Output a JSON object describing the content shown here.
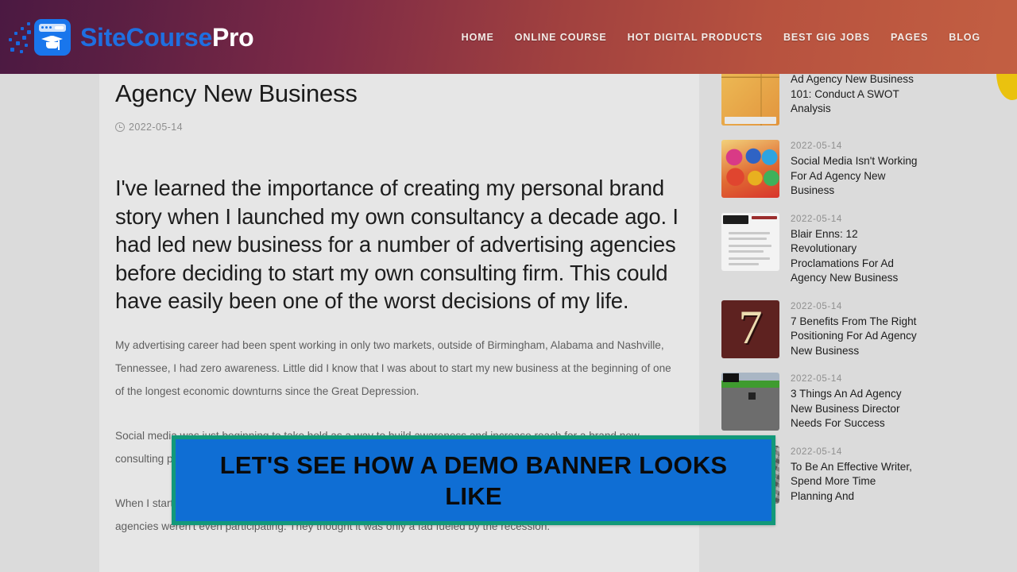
{
  "header": {
    "brand_primary": "SiteCourse",
    "brand_secondary": "Pro",
    "nav": [
      {
        "label": "HOME"
      },
      {
        "label": "ONLINE COURSE"
      },
      {
        "label": "HOT DIGITAL PRODUCTS"
      },
      {
        "label": "BEST GIG JOBS"
      },
      {
        "label": "PAGES"
      },
      {
        "label": "BLOG"
      }
    ],
    "accent_blue": "#1976ec",
    "gradient_start": "#4b1942",
    "gradient_end": "#c35f42"
  },
  "article": {
    "title": "Agency New Business",
    "date": "2022-05-14",
    "lead": "I've learned the importance of creating my personal brand story when I launched my own consultancy a decade ago. I had led new business for a number of advertising agencies before deciding to start my own consulting firm. This could have easily been one of the worst decisions of my life.",
    "paragraph_1": "My advertising career had been spent working in only two markets, outside of Birmingham, Alabama and Nashville, Tennessee, I had zero awareness. Little did I know that I was about to start my new business at the beginning of one of the longest economic downturns since the Great Depression.",
    "paragraph_2": "Social media was just beginning to take hold as a way to build awareness and increase reach for a brand new consulting practice.",
    "paragraph_3": "When I started my consultancy, social media was only beginning to evolve as a new communication channel. Most agencies weren't even participating. They thought it was only a fad fueled by the recession."
  },
  "demo_banner": {
    "text": "LET'S SEE HOW A DEMO BANNER LOOKS LIKE",
    "background": "#0f6ed4",
    "border_color": "#12997a",
    "text_color": "#0a0a0a"
  },
  "sidebar": {
    "items": [
      {
        "date": "",
        "title": "Ad Agency New Business 101: Conduct A SWOT Analysis",
        "thumb": "swot-chart-thumbnail"
      },
      {
        "date": "2022-05-14",
        "title": "Social Media Isn't Working For Ad Agency New Business",
        "thumb": "social-media-icons-thumbnail"
      },
      {
        "date": "2022-05-14",
        "title": "Blair Enns: 12 Revolutionary Proclamations For Ad Agency New Business",
        "thumb": "document-thumbnail"
      },
      {
        "date": "2022-05-14",
        "title": "7 Benefits From The Right Positioning For Ad Agency New Business",
        "thumb": "number-seven-thumbnail"
      },
      {
        "date": "2022-05-14",
        "title": "3 Things An Ad Agency New Business Director Needs For Success",
        "thumb": "green-board-thumbnail"
      },
      {
        "date": "2022-05-14",
        "title": "To Be An Effective Writer, Spend More Time Planning And",
        "thumb": "keyboard-thumbnail"
      }
    ]
  },
  "widgets": {
    "corner_circle_color": "#eac20f"
  }
}
